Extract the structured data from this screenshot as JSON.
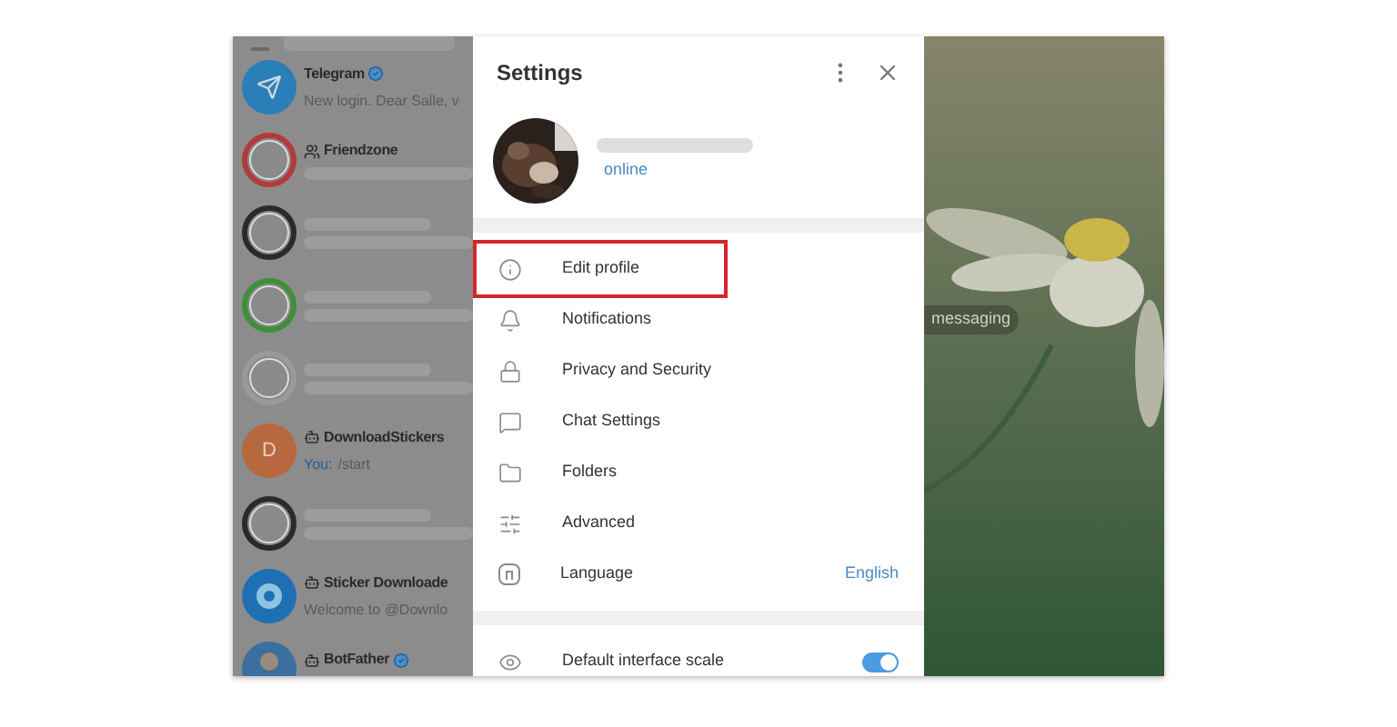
{
  "chats": [
    {
      "kind": "official",
      "name": "Telegram",
      "verified": true,
      "preview": "New login. Dear Salle, v",
      "color": "#2b7fb8"
    },
    {
      "kind": "group",
      "name": "Friendzone",
      "verified": false,
      "color": "#b23a3a"
    },
    {
      "kind": "hidden",
      "color": "#2a2a2a"
    },
    {
      "kind": "hidden",
      "color": "#3f8f3a"
    },
    {
      "kind": "hidden",
      "color": "#9a9a9a"
    },
    {
      "kind": "bot_letter",
      "name": "DownloadStickers",
      "verified": false,
      "letter": "D",
      "sender": "You:",
      "preview": "/start",
      "color": "#b8683f"
    },
    {
      "kind": "hidden",
      "color": "#2a2a2a"
    },
    {
      "kind": "bot_ring",
      "name": "Sticker Downloade",
      "verified": false,
      "preview": "Welcome to @Downlo",
      "color": "#1f6fb5"
    },
    {
      "kind": "bot_person",
      "name": "BotFather",
      "verified": true,
      "color": "#3b6f9e"
    }
  ],
  "settings": {
    "title": "Settings",
    "status": "online",
    "items": [
      {
        "kind": "info",
        "label": "Edit profile",
        "highlighted": true
      },
      {
        "kind": "bell",
        "label": "Notifications",
        "highlighted": false
      },
      {
        "kind": "lock",
        "label": "Privacy and Security",
        "highlighted": false
      },
      {
        "kind": "chat",
        "label": "Chat Settings",
        "highlighted": false
      },
      {
        "kind": "folder",
        "label": "Folders",
        "highlighted": false
      },
      {
        "kind": "sliders",
        "label": "Advanced",
        "highlighted": false
      },
      {
        "kind": "language",
        "label": "Language",
        "value": "English",
        "highlighted": false
      }
    ],
    "scale": {
      "label": "Default interface scale",
      "on": true
    }
  },
  "background": {
    "hint": "messaging"
  }
}
